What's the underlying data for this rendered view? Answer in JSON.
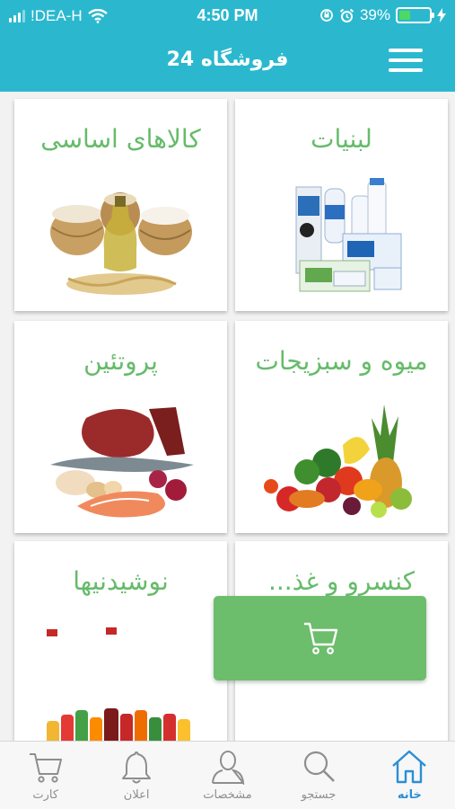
{
  "status_bar": {
    "carrier": "!DEA-H",
    "time": "4:50 PM",
    "battery": "39%",
    "battery_level": 0.39
  },
  "header": {
    "title": "فروشگاه 24",
    "menu_icon": "hamburger-menu-icon"
  },
  "categories": [
    {
      "label": "لبنیات",
      "image": "dairy-products-image"
    },
    {
      "label": "کالاهای اساسی",
      "image": "grains-and-oil-image"
    },
    {
      "label": "میوه و سبزیجات",
      "image": "fruits-and-vegetables-image"
    },
    {
      "label": "پروتئین",
      "image": "meat-and-fish-image"
    },
    {
      "label": "کنسرو و غذ...",
      "image": "canned-food-image"
    },
    {
      "label": "نوشیدنیها",
      "image": "soft-drinks-image"
    }
  ],
  "cart_fab": {
    "icon": "shopping-cart-icon"
  },
  "tabs": [
    {
      "label": "خانه",
      "icon": "home-icon",
      "active": true
    },
    {
      "label": "جستجو",
      "icon": "search-icon",
      "active": false
    },
    {
      "label": "مشخصات",
      "icon": "profile-icon",
      "active": false
    },
    {
      "label": "اعلان",
      "icon": "bell-icon",
      "active": false
    },
    {
      "label": "کارت",
      "icon": "cart-icon",
      "active": false
    }
  ],
  "colors": {
    "primary": "#2bb8cf",
    "accent_green": "#66bb6a",
    "tab_active": "#2b8fd6",
    "tab_inactive": "#8e8e8e"
  }
}
